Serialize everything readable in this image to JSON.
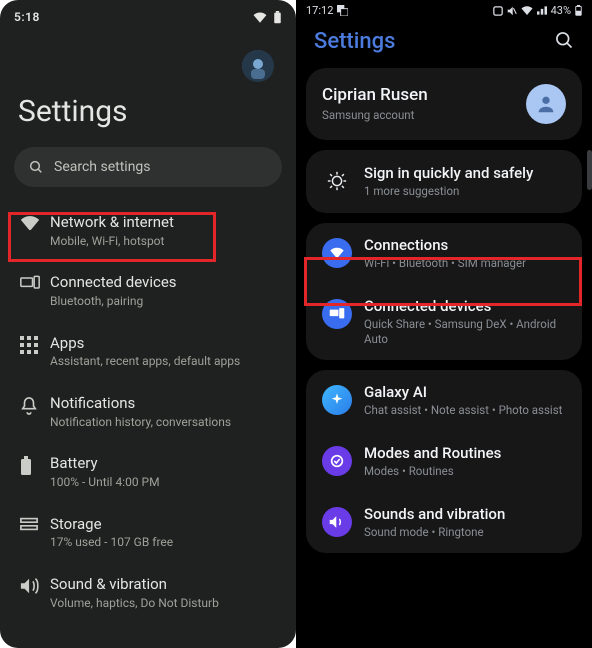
{
  "left": {
    "status": {
      "time": "5:18"
    },
    "title": "Settings",
    "search_placeholder": "Search settings",
    "items": [
      {
        "title": "Network & internet",
        "sub": "Mobile, Wi-Fi, hotspot"
      },
      {
        "title": "Connected devices",
        "sub": "Bluetooth, pairing"
      },
      {
        "title": "Apps",
        "sub": "Assistant, recent apps, default apps"
      },
      {
        "title": "Notifications",
        "sub": "Notification history, conversations"
      },
      {
        "title": "Battery",
        "sub": "100% - Until 4:00 PM"
      },
      {
        "title": "Storage",
        "sub": "17% used - 107 GB free"
      },
      {
        "title": "Sound & vibration",
        "sub": "Volume, haptics, Do Not Disturb"
      }
    ]
  },
  "right": {
    "status": {
      "time": "17:12",
      "battery": "43%"
    },
    "title": "Settings",
    "account": {
      "name": "Ciprian Rusen",
      "sub": "Samsung account"
    },
    "signin": {
      "title": "Sign in quickly and safely",
      "sub": "1 more suggestion"
    },
    "group1": [
      {
        "title": "Connections",
        "sub": "Wi-Fi • Bluetooth • SIM manager"
      },
      {
        "title": "Connected devices",
        "sub": "Quick Share • Samsung DeX • Android Auto"
      }
    ],
    "group2": [
      {
        "title": "Galaxy AI",
        "sub": "Chat assist • Note assist • Photo assist"
      },
      {
        "title": "Modes and Routines",
        "sub": "Modes • Routines"
      },
      {
        "title": "Sounds and vibration",
        "sub": "Sound mode • Ringtone"
      }
    ]
  }
}
